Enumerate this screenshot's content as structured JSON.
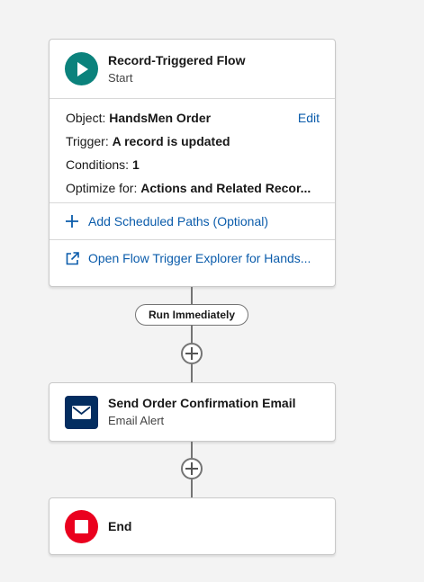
{
  "start_node": {
    "title": "Record-Triggered Flow",
    "subtitle": "Start",
    "icon": "play-icon",
    "object_label": "Object:",
    "object_value": "HandsMen Order",
    "edit_label": "Edit",
    "trigger_label": "Trigger:",
    "trigger_value": "A record is updated",
    "conditions_label": "Conditions:",
    "conditions_value": "1",
    "optimize_label": "Optimize for:",
    "optimize_value": "Actions and Related Recor...",
    "add_paths_label": "Add Scheduled Paths (Optional)",
    "explorer_label": "Open Flow Trigger Explorer for Hands..."
  },
  "path_label": "Run Immediately",
  "email_node": {
    "title": "Send Order Confirmation Email",
    "subtitle": "Email Alert",
    "icon": "envelope-icon"
  },
  "end_node": {
    "title": "End",
    "icon": "stop-icon"
  },
  "colors": {
    "background": "#f3f3f3",
    "start_icon": "#0b827c",
    "email_icon": "#032d60",
    "end_icon": "#ea001e",
    "link": "#0b5cab",
    "connector": "#747474"
  }
}
